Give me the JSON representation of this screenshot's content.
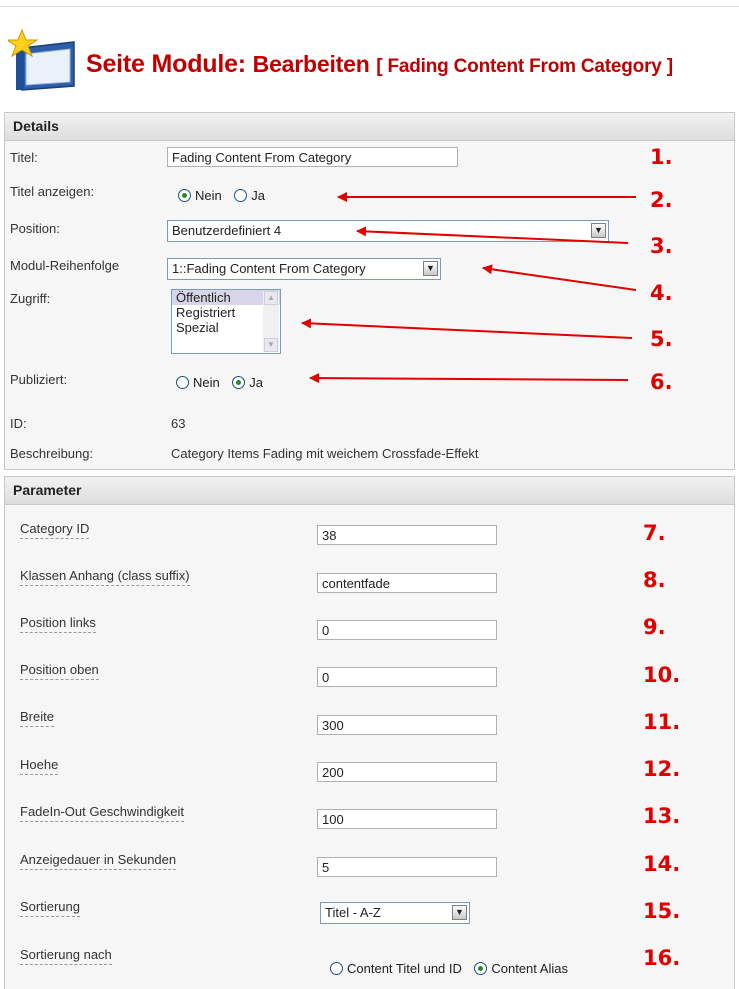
{
  "header": {
    "title_part1": "Seite Module:",
    "title_part2": "Bearbeiten",
    "title_part3": "[ Fading Content From Category ]",
    "icon": "module-icon"
  },
  "details": {
    "heading": "Details",
    "titel_label": "Titel:",
    "titel_value": "Fading Content From Category",
    "titel_anzeigen_label": "Titel anzeigen:",
    "titel_anzeigen_options": [
      "Nein",
      "Ja"
    ],
    "titel_anzeigen_selected": "Nein",
    "position_label": "Position:",
    "position_value": "Benutzerdefiniert 4",
    "reihenfolge_label": "Modul-Reihenfolge",
    "reihenfolge_value": "1::Fading Content From Category",
    "zugriff_label": "Zugriff:",
    "zugriff_options": [
      "Öffentlich",
      "Registriert",
      "Spezial"
    ],
    "zugriff_selected": "Öffentlich",
    "publiziert_label": "Publiziert:",
    "publiziert_options": [
      "Nein",
      "Ja"
    ],
    "publiziert_selected": "Ja",
    "id_label": "ID:",
    "id_value": "63",
    "beschreibung_label": "Beschreibung:",
    "beschreibung_value": "Category Items Fading mit weichem Crossfade-Effekt"
  },
  "parameter": {
    "heading": "Parameter",
    "fields": [
      {
        "label": "Category ID",
        "value": "38"
      },
      {
        "label": "Klassen Anhang (class suffix)",
        "value": "contentfade"
      },
      {
        "label": "Position links",
        "value": "0"
      },
      {
        "label": "Position oben",
        "value": "0"
      },
      {
        "label": "Breite",
        "value": "300"
      },
      {
        "label": "Hoehe",
        "value": "200"
      },
      {
        "label": "FadeIn-Out Geschwindigkeit",
        "value": "100"
      },
      {
        "label": "Anzeigedauer in Sekunden",
        "value": "5"
      }
    ],
    "sortierung_label": "Sortierung",
    "sortierung_value": "Titel - A-Z",
    "sortierung_nach_label": "Sortierung nach",
    "sortierung_nach_options": [
      "Content Titel und ID",
      "Content Alias"
    ],
    "sortierung_nach_selected": "Content Alias"
  },
  "annotations": [
    "1.",
    "2.",
    "3.",
    "4.",
    "5.",
    "6.",
    "7.",
    "8.",
    "9.",
    "10.",
    "11.",
    "12.",
    "13.",
    "14.",
    "15.",
    "16."
  ],
  "colors": {
    "annotation": "#e00000",
    "title": "#c00000",
    "radio_on": "#2a8a2a"
  }
}
